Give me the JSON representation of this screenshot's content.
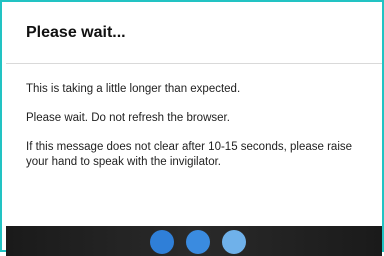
{
  "dialog": {
    "title": "Please wait...",
    "messages": [
      "This is taking a little longer than expected.",
      "Please wait. Do not refresh the browser.",
      "If this message does not clear after 10-15 seconds, please raise your hand to speak with the invigilator."
    ]
  },
  "colors": {
    "frame_border": "#22c3c3",
    "loader_dot_1": "#2f7fd8",
    "loader_dot_2": "#3a8be0",
    "loader_dot_3": "#6fb1ea",
    "loader_background": "#1a1a1a"
  }
}
